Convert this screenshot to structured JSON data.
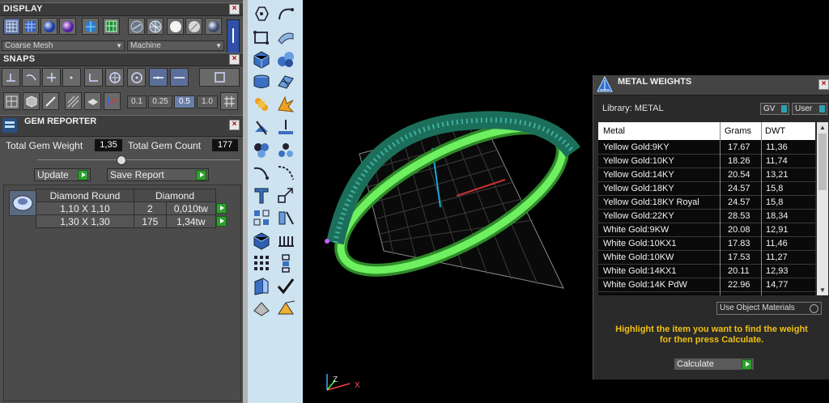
{
  "display_panel": {
    "title": "DISPLAY",
    "mesh_mode": "Coarse Mesh",
    "render_mode": "Machine"
  },
  "snaps_panel": {
    "title": "SNAPS",
    "snap_values": [
      "0.1",
      "0.25",
      "0.5",
      "1.0"
    ],
    "selected_snap": "0.5"
  },
  "gem_reporter": {
    "title": "GEM REPORTER",
    "total_weight_label": "Total Gem Weight",
    "total_weight_value": "1,35",
    "total_count_label": "Total Gem Count",
    "total_count_value": "177",
    "update_label": "Update",
    "save_report_label": "Save Report",
    "table_headers": [
      "Diamond Round",
      "Diamond"
    ],
    "rows": [
      {
        "size": "1,10 X 1,10",
        "count": "2",
        "weight": "0,010tw"
      },
      {
        "size": "1,30 X 1,30",
        "count": "175",
        "weight": "1,34tw"
      }
    ]
  },
  "metal_weights": {
    "title": "METAL WEIGHTS",
    "library_label": "Library: METAL",
    "gv_label": "GV",
    "user_label": "User",
    "columns": [
      "Metal",
      "Grams",
      "DWT"
    ],
    "rows": [
      {
        "metal": "Yellow Gold:9KY",
        "grams": "17.67",
        "dwt": "11,36"
      },
      {
        "metal": "Yellow Gold:10KY",
        "grams": "18.26",
        "dwt": "11,74"
      },
      {
        "metal": "Yellow Gold:14KY",
        "grams": "20.54",
        "dwt": "13,21"
      },
      {
        "metal": "Yellow Gold:18KY",
        "grams": "24.57",
        "dwt": "15,8"
      },
      {
        "metal": "Yellow Gold:18KY Royal",
        "grams": "24.57",
        "dwt": "15,8"
      },
      {
        "metal": "Yellow Gold:22KY",
        "grams": "28.53",
        "dwt": "18,34"
      },
      {
        "metal": "White Gold:9KW",
        "grams": "20.08",
        "dwt": "12,91"
      },
      {
        "metal": "White Gold:10KX1",
        "grams": "17.83",
        "dwt": "11,46"
      },
      {
        "metal": "White Gold:10KW",
        "grams": "17.53",
        "dwt": "11,27"
      },
      {
        "metal": "White Gold:14KX1",
        "grams": "20.11",
        "dwt": "12,93"
      },
      {
        "metal": "White Gold:14K PdW",
        "grams": "22.96",
        "dwt": "14,77"
      }
    ],
    "use_object_materials": "Use Object Materials",
    "hint_line1": "Highlight the item you want to find the weight",
    "hint_line2": "for then press Calculate.",
    "calculate_label": "Calculate"
  },
  "viewport": {
    "axis_x": "X",
    "axis_z": "Z"
  },
  "colors": {
    "accent_green": "#2e9f2e",
    "hint_yellow": "#f0c010",
    "toolbar_bg": "#cde3ef",
    "ring_green": "#55e04a"
  }
}
